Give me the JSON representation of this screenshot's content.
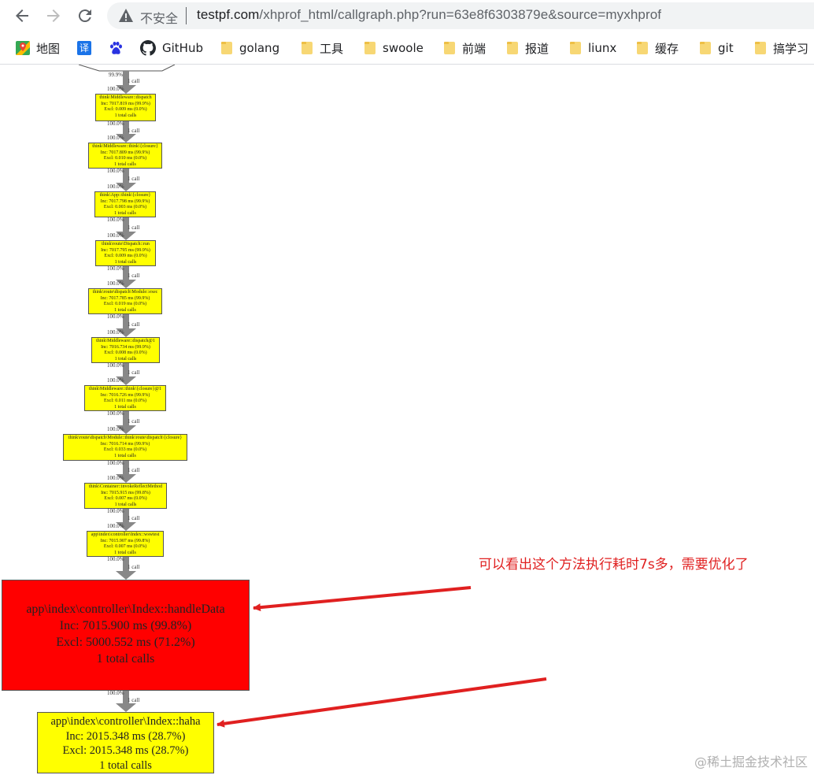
{
  "browser": {
    "security_label": "不安全",
    "url_host": "testpf.com",
    "url_rest": "/xhprof_html/callgraph.php?run=63e8f6303879e&source=myxhprof"
  },
  "bookmarks": [
    {
      "label": "地图",
      "icon": "maps-icon"
    },
    {
      "label": "",
      "icon": "translate-icon",
      "glyph": "译"
    },
    {
      "label": "",
      "icon": "baidu-paw-icon"
    },
    {
      "label": "GitHub",
      "icon": "github-icon"
    },
    {
      "label": "golang",
      "icon": "folder-icon"
    },
    {
      "label": "工具",
      "icon": "folder-icon"
    },
    {
      "label": "swoole",
      "icon": "folder-icon"
    },
    {
      "label": "前端",
      "icon": "folder-icon"
    },
    {
      "label": "报道",
      "icon": "folder-icon"
    },
    {
      "label": "liunx",
      "icon": "folder-icon"
    },
    {
      "label": "缓存",
      "icon": "folder-icon"
    },
    {
      "label": "git",
      "icon": "folder-icon"
    },
    {
      "label": "搞学习",
      "icon": "folder-icon"
    }
  ],
  "graph": {
    "top_edge_label": "99.9%",
    "edge_pct": "100.0%",
    "edge_calls": "1 call",
    "nodes": [
      {
        "name": "think\\Middleware::dispatch",
        "inc": "Inc: 7017.819 ms (99.9%)",
        "excl": "Excl: 0.009 ms (0.0%)",
        "calls": "1 total calls"
      },
      {
        "name": "think\\Middleware::think\\{closure}",
        "inc": "Inc: 7017.809 ms (99.9%)",
        "excl": "Excl: 0.010 ms (0.0%)",
        "calls": "1 total calls"
      },
      {
        "name": "think\\App::think\\{closure}",
        "inc": "Inc: 7017.798 ms (99.9%)",
        "excl": "Excl: 0.003 ms (0.0%)",
        "calls": "1 total calls"
      },
      {
        "name": "think\\route\\Dispatch::run",
        "inc": "Inc: 7017.795 ms (99.9%)",
        "excl": "Excl: 0.009 ms (0.0%)",
        "calls": "1 total calls"
      },
      {
        "name": "think\\route\\dispatch\\Module::exec",
        "inc": "Inc: 7017.785 ms (99.9%)",
        "excl": "Excl: 0.019 ms (0.0%)",
        "calls": "1 total calls"
      },
      {
        "name": "think\\Middleware::dispatch@1",
        "inc": "Inc: 7016.734 ms (99.9%)",
        "excl": "Excl: 0.008 ms (0.0%)",
        "calls": "1 total calls"
      },
      {
        "name": "think\\Middleware::think\\{closure}@1",
        "inc": "Inc: 7016.726 ms (99.9%)",
        "excl": "Excl: 0.011 ms (0.0%)",
        "calls": "1 total calls"
      },
      {
        "name": "think\\route\\dispatch\\Module::think\\route\\dispatch\\{closure}",
        "inc": "Inc: 7016.714 ms (99.9%)",
        "excl": "Excl: 0.033 ms (0.0%)",
        "calls": "1 total calls"
      },
      {
        "name": "think\\Container::invokeReflectMethod",
        "inc": "Inc: 7015.915 ms (99.8%)",
        "excl": "Excl: 0.007 ms (0.0%)",
        "calls": "1 total calls"
      },
      {
        "name": "app\\index\\controller\\Index::wswtest",
        "inc": "Inc: 7015.907 ms (99.8%)",
        "excl": "Excl: 0.007 ms (0.0%)",
        "calls": "1 total calls"
      }
    ],
    "hot_node": {
      "name": "app\\index\\controller\\Index::handleData",
      "inc": "Inc: 7015.900 ms (99.8%)",
      "excl": "Excl: 5000.552 ms (71.2%)",
      "calls": "1 total calls",
      "color": "#ff0000"
    },
    "last_node": {
      "name": "app\\index\\controller\\Index::haha",
      "inc": "Inc: 2015.348 ms (28.7%)",
      "excl": "Excl: 2015.348 ms (28.7%)",
      "calls": "1 total calls",
      "color": "#ffff00"
    }
  },
  "annotation": {
    "text": "可以看出这个方法执行耗时7s多，需要优化了",
    "color": "#e02020"
  },
  "watermark": "@稀土掘金技术社区"
}
